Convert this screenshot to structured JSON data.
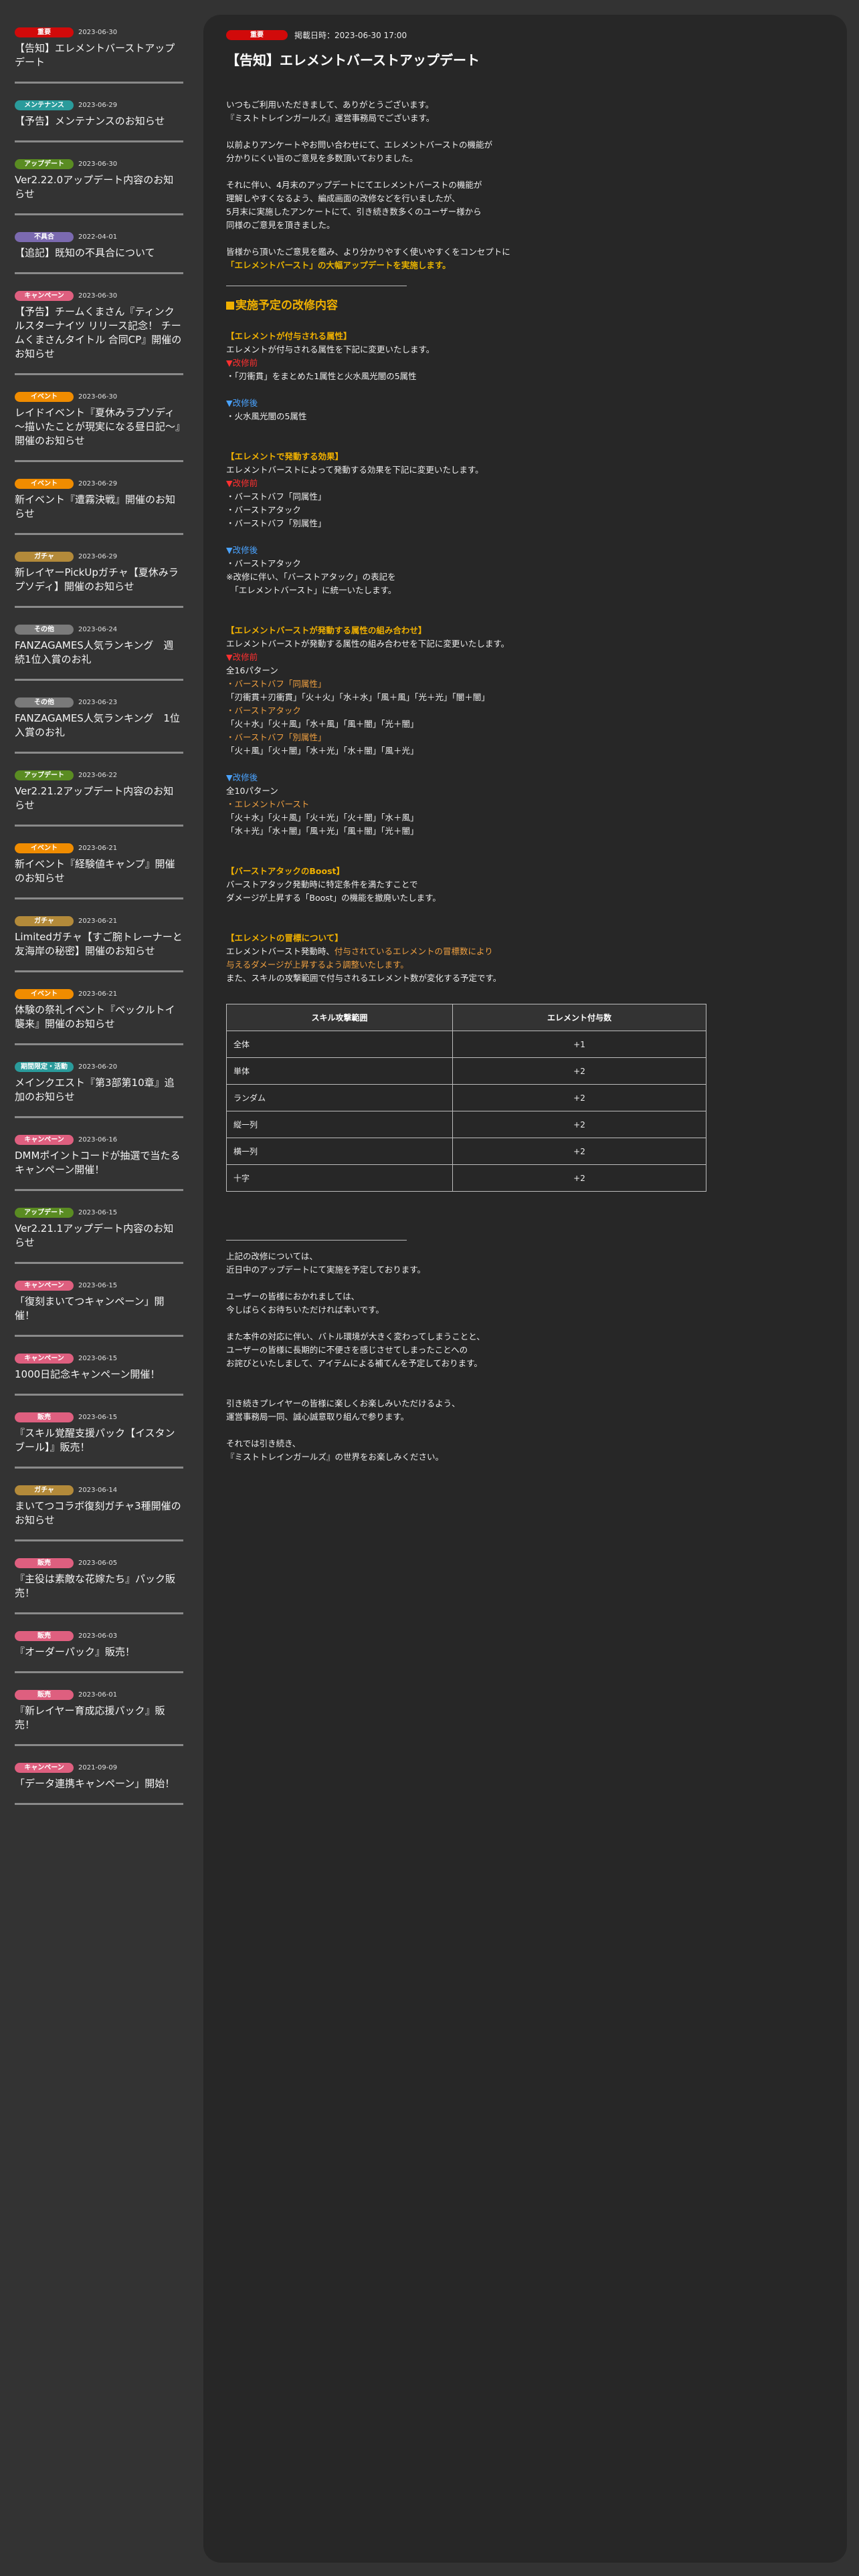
{
  "colors": {
    "important": "#d10a0a",
    "maintenance": "#2a9b9b",
    "update": "#5a8c22",
    "bug": "#7b6ab0",
    "campaign": "#de5f7f",
    "event": "#f08c00",
    "gacha": "#b38a3a",
    "other": "#7a7a7a",
    "limited_quest": "#2a9b9b",
    "sale": "#de5f7f"
  },
  "sidebar": {
    "items": [
      {
        "tag": "重要",
        "color": "#d10a0a",
        "date": "2023-06-30",
        "title": "【告知】エレメントバーストアップデート"
      },
      {
        "tag": "メンテナンス",
        "color": "#2a9b9b",
        "date": "2023-06-29",
        "title": "【予告】メンテナンスのお知らせ"
      },
      {
        "tag": "アップデート",
        "color": "#5a8c22",
        "date": "2023-06-30",
        "title": "Ver2.22.0アップデート内容のお知らせ"
      },
      {
        "tag": "不具合",
        "color": "#7b6ab0",
        "date": "2022-04-01",
        "title": "【追記】既知の不具合について"
      },
      {
        "tag": "キャンペーン",
        "color": "#de5f7f",
        "date": "2023-06-30",
        "title": "【予告】チームくまさん『ティンクルスターナイツ リリース記念！ チームくまさんタイトル 合同CP』開催のお知らせ"
      },
      {
        "tag": "イベント",
        "color": "#f08c00",
        "date": "2023-06-30",
        "title": "レイドイベント『夏休みラプソディ ～描いたことが現実になる昼日記～』開催のお知らせ"
      },
      {
        "tag": "イベント",
        "color": "#f08c00",
        "date": "2023-06-29",
        "title": "新イベント『遭霧決戦』開催のお知らせ"
      },
      {
        "tag": "ガチャ",
        "color": "#b38a3a",
        "date": "2023-06-29",
        "title": "新レイヤーPickUpガチャ【夏休みラプソディ】開催のお知らせ"
      },
      {
        "tag": "その他",
        "color": "#7a7a7a",
        "date": "2023-06-24",
        "title": "FANZAGAMES人気ランキング　週続1位入賞のお礼"
      },
      {
        "tag": "その他",
        "color": "#7a7a7a",
        "date": "2023-06-23",
        "title": "FANZAGAMES人気ランキング　1位入賞のお礼"
      },
      {
        "tag": "アップデート",
        "color": "#5a8c22",
        "date": "2023-06-22",
        "title": "Ver2.21.2アップデート内容のお知らせ"
      },
      {
        "tag": "イベント",
        "color": "#f08c00",
        "date": "2023-06-21",
        "title": "新イベント『経験値キャンプ』開催のお知らせ"
      },
      {
        "tag": "ガチャ",
        "color": "#b38a3a",
        "date": "2023-06-21",
        "title": "Limitedガチャ【すご腕トレーナーと友海岸の秘密】開催のお知らせ"
      },
      {
        "tag": "イベント",
        "color": "#f08c00",
        "date": "2023-06-21",
        "title": "体験の祭礼イベント『ベックルトイ襲来』開催のお知らせ"
      },
      {
        "tag": "期間限定・活動",
        "color": "#2a9b9b",
        "date": "2023-06-20",
        "title": "メインクエスト『第3部第10章』追加のお知らせ"
      },
      {
        "tag": "キャンペーン",
        "color": "#de5f7f",
        "date": "2023-06-16",
        "title": "DMMポイントコードが抽選で当たるキャンペーン開催！"
      },
      {
        "tag": "アップデート",
        "color": "#5a8c22",
        "date": "2023-06-15",
        "title": "Ver2.21.1アップデート内容のお知らせ"
      },
      {
        "tag": "キャンペーン",
        "color": "#de5f7f",
        "date": "2023-06-15",
        "title": "「復刻まいてつキャンペーン」開催！"
      },
      {
        "tag": "キャンペーン",
        "color": "#de5f7f",
        "date": "2023-06-15",
        "title": "1000日記念キャンペーン開催！"
      },
      {
        "tag": "販売",
        "color": "#de5f7f",
        "date": "2023-06-15",
        "title": "『スキル覚醒支援パック【イスタンブール】』販売！"
      },
      {
        "tag": "ガチャ",
        "color": "#b38a3a",
        "date": "2023-06-14",
        "title": "まいてつコラボ復刻ガチャ3種開催のお知らせ"
      },
      {
        "tag": "販売",
        "color": "#de5f7f",
        "date": "2023-06-05",
        "title": "『主役は素敵な花嫁たち』パック販売！"
      },
      {
        "tag": "販売",
        "color": "#de5f7f",
        "date": "2023-06-03",
        "title": "『オーダーパック』販売！"
      },
      {
        "tag": "販売",
        "color": "#de5f7f",
        "date": "2023-06-01",
        "title": "『新レイヤー育成応援パック』販売！"
      },
      {
        "tag": "キャンペーン",
        "color": "#de5f7f",
        "date": "2021-09-09",
        "title": "「データ連携キャンペーン」開始！"
      }
    ]
  },
  "article": {
    "tag": "重要",
    "published": "掲載日時：2023-06-30 17:00",
    "title": "【告知】エレメントバーストアップデート",
    "intro1": [
      "いつもご利用いただきまして、ありがとうございます。",
      "『ミストトレインガールズ』運営事務局でございます。"
    ],
    "intro2": [
      "以前よりアンケートやお問い合わせにて、エレメントバーストの機能が",
      "分かりにくい旨のご意見を多数頂いておりました。"
    ],
    "intro3": [
      "それに伴い、4月末のアップデートにてエレメントバーストの機能が",
      "理解しやすくなるよう、編成画面の改修などを行いましたが、",
      "5月末に実施したアンケートにて、引き続き数多くのユーザー様から",
      "同様のご意見を頂きました。"
    ],
    "intro4": "皆様から頂いたご意見を鑑み、より分かりやすく使いやすくをコンセプトに",
    "intro4_gold": "「エレメントバースト」の大幅アップデートを実施します。",
    "section_title": "実施予定の改修内容",
    "s1_title": "【エレメントが付与される属性】",
    "s1_desc": "エレメントが付与される属性を下記に変更いたします。",
    "before_label": "▼改修前",
    "after_label": "▼改修後",
    "s1_before": "・「刃衝貫」をまとめた1属性と火水風光闇の5属性",
    "s1_after": "・火水風光闇の5属性",
    "s2_title": "【エレメントで発動する効果】",
    "s2_desc": "エレメントバーストによって発動する効果を下記に変更いたします。",
    "s2_before": [
      "・バーストバフ「同属性」",
      "・バーストアタック",
      "・バーストバフ「別属性」"
    ],
    "s2_after": [
      "・バーストアタック",
      "※改修に伴い、「バーストアタック」の表記を",
      "　「エレメントバースト」に統一いたします。"
    ],
    "s3_title": "【エレメントバーストが発動する属性の組み合わせ】",
    "s3_desc": "エレメントバーストが発動する属性の組み合わせを下記に変更いたします。",
    "s3_before_count": "全16パターン",
    "s3_b1_label": "・バーストバフ「同属性」",
    "s3_b1": "「刃衝貫＋刃衝貫」「火＋火」「水＋水」「風＋風」「光＋光」「闇＋闇」",
    "s3_b2_label": "・バーストアタック",
    "s3_b2": "「火＋水」「火＋風」「水＋風」「風＋闇」「光＋闇」",
    "s3_b3_label": "・バーストバフ「別属性」",
    "s3_b3": "「火＋風」「火＋闇」「水＋光」「水＋闇」「風＋光」",
    "s3_after_count": "全10パターン",
    "s3_a1_label": "・エレメントバースト",
    "s3_a1": "「火＋水」「火＋風」「火＋光」「火＋闇」「水＋風」",
    "s3_a2": "「水＋光」「水＋闇」「風＋光」「風＋闇」「光＋闇」",
    "s4_title": "【バーストアタックのBoost】",
    "s4_body": [
      "バーストアタック発動時に特定条件を満たすことで",
      "ダメージが上昇する「Boost」の機能を撤廃いたします。"
    ],
    "s5_title": "【エレメントの冒標について】",
    "s5_line1_pre": "エレメントバースト発動時、",
    "s5_line1_orange": "付与されているエレメントの冒標数により",
    "s5_line2_orange": "与えるダメージが上昇するよう調整いたします。",
    "s5_line3": "また、スキルの攻撃範囲で付与されるエレメント数が変化する予定です。",
    "table": {
      "headers": [
        "スキル攻撃範囲",
        "エレメント付与数"
      ],
      "rows": [
        [
          "全体",
          "+1"
        ],
        [
          "単体",
          "+2"
        ],
        [
          "ランダム",
          "+2"
        ],
        [
          "縦一列",
          "+2"
        ],
        [
          "横一列",
          "+2"
        ],
        [
          "十字",
          "+2"
        ]
      ]
    },
    "outro1": [
      "上記の改修については、",
      "近日中のアップデートにて実施を予定しております。"
    ],
    "outro2": [
      "ユーザーの皆様におかれましては、",
      "今しばらくお待ちいただければ幸いです。"
    ],
    "outro3": [
      "また本件の対応に伴い、バトル環境が大きく変わってしまうことと、",
      "ユーザーの皆様に長期的に不便さを感じさせてしまったことへの",
      "お詫びといたしまして、アイテムによる補てんを予定しております。"
    ],
    "outro4": [
      "引き続きプレイヤーの皆様に楽しくお楽しみいただけるよう、",
      "運営事務局一同、誠心誠意取り組んで参ります。"
    ],
    "outro5": [
      "それでは引き続き、",
      "『ミストトレインガールズ』の世界をお楽しみください。"
    ]
  }
}
